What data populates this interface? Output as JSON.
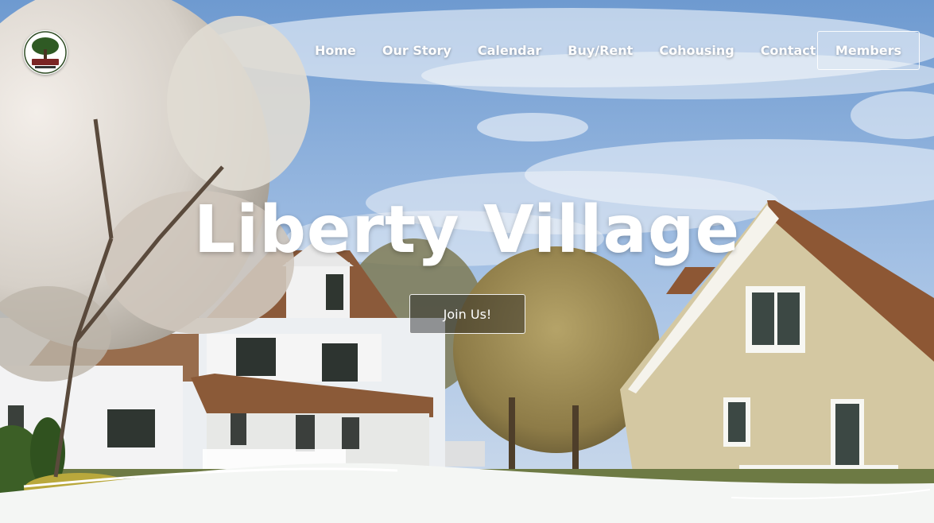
{
  "brand": {
    "logo_icon": "tree-logo-icon"
  },
  "nav": {
    "items": [
      {
        "label": "Home"
      },
      {
        "label": "Our Story"
      },
      {
        "label": "Calendar"
      },
      {
        "label": "Buy/Rent"
      },
      {
        "label": "Cohousing"
      },
      {
        "label": "Contact"
      }
    ],
    "members_label": "Members"
  },
  "hero": {
    "title": "Liberty Village",
    "cta_label": "Join Us!"
  },
  "colors": {
    "text": "#ffffff",
    "bottom_wave": "#f4f6f4"
  }
}
